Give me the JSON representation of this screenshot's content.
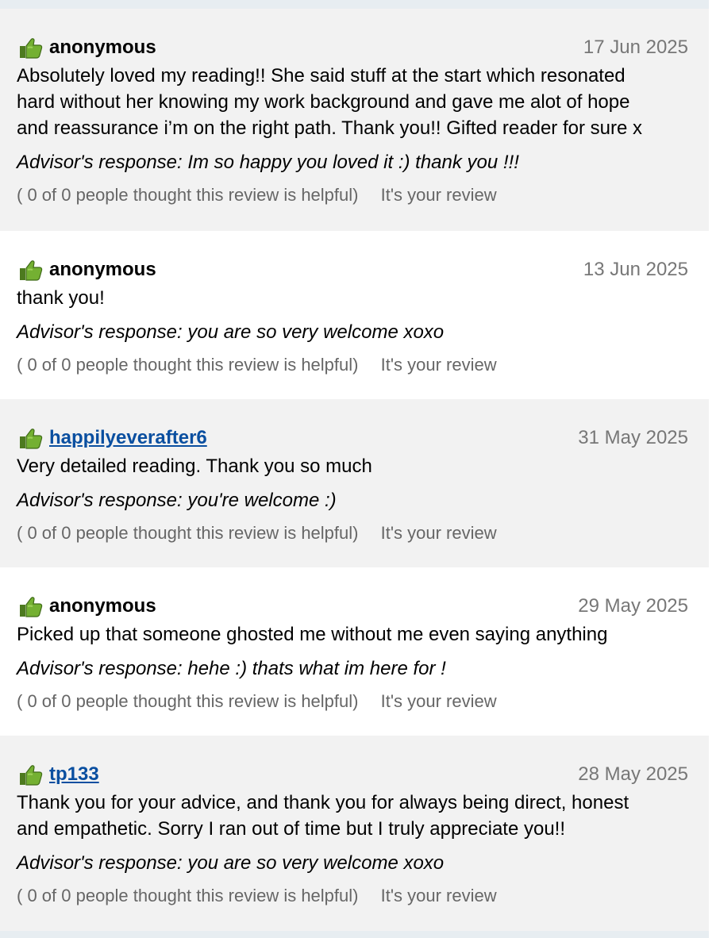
{
  "reviews": [
    {
      "name": "anonymous",
      "date": "17 Jun 2025",
      "text": "Absolutely loved my reading!! She said stuff at the start which resonated\nhard without her knowing my work background and gave me alot of hope\nand reassurance i’m on the right path. Thank you!! Gifted reader for sure x",
      "response": "Advisor's response: Im so happy you loved it :) thank you !!!",
      "helpful": "( 0 of 0 people thought this review is helpful)",
      "own": "It's your review"
    },
    {
      "name": "anonymous",
      "date": "13 Jun 2025",
      "text": "thank you!",
      "response": "Advisor's response: you are so very welcome xoxo",
      "helpful": "( 0 of 0 people thought this review is helpful)",
      "own": "It's your review"
    },
    {
      "name": "happilyeverafter6",
      "date": "31 May 2025",
      "text": "Very detailed reading. Thank you so much",
      "response": "Advisor's response: you're welcome :)",
      "helpful": "( 0 of 0 people thought this review is helpful)",
      "own": "It's your review"
    },
    {
      "name": "anonymous",
      "date": "29 May 2025",
      "text": "Picked up that someone ghosted me without me even saying anything",
      "response": "Advisor's response: hehe :) thats what im here for !",
      "helpful": "( 0 of 0 people thought this review is helpful)",
      "own": "It's your review"
    },
    {
      "name": "tp133",
      "date": "28 May 2025",
      "text": "Thank you for your advice, and thank you for always being direct, honest\nand empathetic. Sorry I ran out of time but I truly appreciate you!!",
      "response": "Advisor's response: you are so very welcome xoxo",
      "helpful": "( 0 of 0 people thought this review is helpful)",
      "own": "It's your review"
    }
  ],
  "icons": {
    "rating": "thumbs-up-icon"
  },
  "colors": {
    "link": "#0a4fa0",
    "shaded_bg": "#f2f2f2",
    "muted_text": "#777777",
    "thumb_green": "#6aa52e"
  }
}
